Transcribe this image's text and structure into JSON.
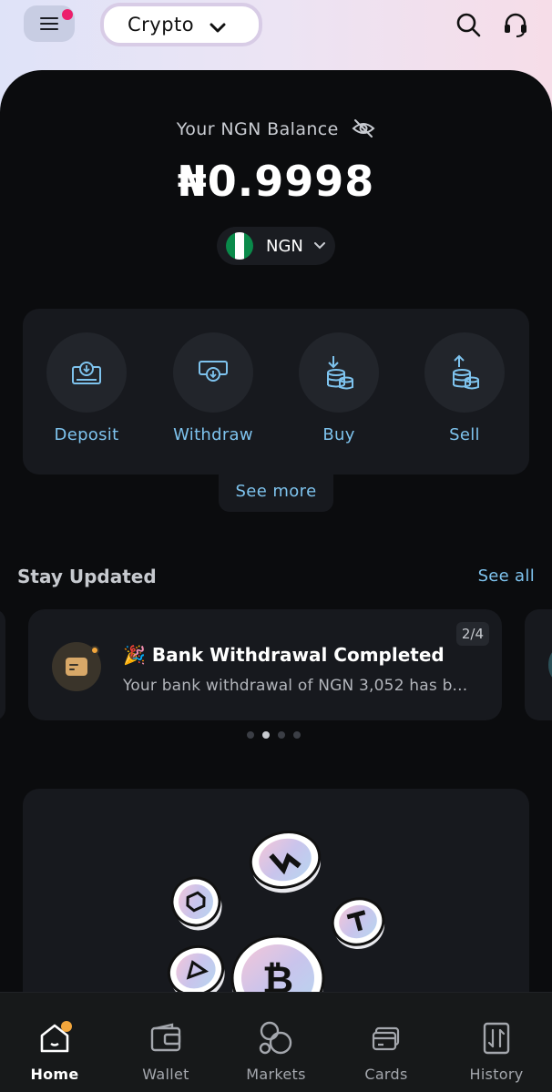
{
  "header": {
    "wallet_type": "Crypto",
    "icons": [
      "menu-icon",
      "chevron-down-icon",
      "search-icon",
      "headset-icon"
    ],
    "notification_dot_color": "#ec1f6b"
  },
  "balance": {
    "label": "Your NGN Balance",
    "amount": "₦0.9998",
    "currency": "NGN",
    "hide_icon": "eye-off-icon"
  },
  "actions": [
    {
      "label": "Deposit",
      "icon": "deposit-icon"
    },
    {
      "label": "Withdraw",
      "icon": "withdraw-icon"
    },
    {
      "label": "Buy",
      "icon": "buy-coins-icon"
    },
    {
      "label": "Sell",
      "icon": "sell-coins-icon"
    }
  ],
  "see_more_label": "See more",
  "updates": {
    "title": "Stay Updated",
    "see_all_label": "See all",
    "card": {
      "emoji": "🎉",
      "title": "Bank Withdrawal Completed",
      "body": "Your bank withdrawal of NGN 3,052 has b...",
      "pager": "2/4"
    },
    "active_dot": 1,
    "dot_count": 4
  },
  "bottom_nav": [
    {
      "label": "Home",
      "icon": "home-icon",
      "active": true
    },
    {
      "label": "Wallet",
      "icon": "wallet-icon",
      "active": false
    },
    {
      "label": "Markets",
      "icon": "markets-icon",
      "active": false
    },
    {
      "label": "Cards",
      "icon": "cards-icon",
      "active": false
    },
    {
      "label": "History",
      "icon": "history-icon",
      "active": false
    }
  ],
  "colors": {
    "accent": "#7ec3ee",
    "panel": "#0b0c0e",
    "card": "#17191e",
    "nav_badge": "#f2a63c"
  }
}
